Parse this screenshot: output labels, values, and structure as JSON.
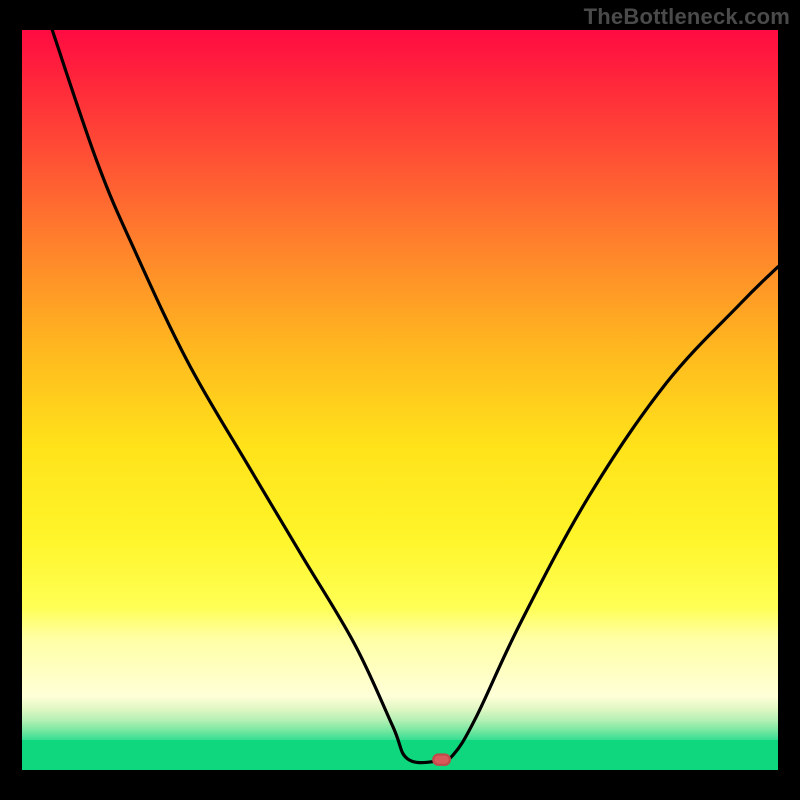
{
  "watermark": "TheBottleneck.com",
  "chart_data": {
    "type": "line",
    "title": "",
    "xlabel": "",
    "ylabel": "",
    "xlim": [
      0,
      100
    ],
    "ylim": [
      0,
      100
    ],
    "grid": false,
    "legend": false,
    "series": [
      {
        "name": "bottleneck-curve",
        "points": [
          {
            "x": 4,
            "y": 100
          },
          {
            "x": 10,
            "y": 82
          },
          {
            "x": 15,
            "y": 70
          },
          {
            "x": 22,
            "y": 55
          },
          {
            "x": 30,
            "y": 41
          },
          {
            "x": 37,
            "y": 29
          },
          {
            "x": 44,
            "y": 17
          },
          {
            "x": 49,
            "y": 6
          },
          {
            "x": 51,
            "y": 1.5
          },
          {
            "x": 55,
            "y": 1.2
          },
          {
            "x": 57,
            "y": 2
          },
          {
            "x": 60,
            "y": 7
          },
          {
            "x": 66,
            "y": 20
          },
          {
            "x": 75,
            "y": 37
          },
          {
            "x": 85,
            "y": 52
          },
          {
            "x": 95,
            "y": 63
          },
          {
            "x": 100,
            "y": 68
          }
        ]
      }
    ],
    "marker": {
      "x": 55.5,
      "y": 1.4,
      "shape": "pill",
      "color": "#d75a5a"
    },
    "background_gradient": {
      "direction": "vertical",
      "stops": [
        {
          "pos": 0.0,
          "color": "#ff0b42"
        },
        {
          "pos": 0.25,
          "color": "#ff5a33"
        },
        {
          "pos": 0.55,
          "color": "#ffb71f"
        },
        {
          "pos": 0.78,
          "color": "#ffff55"
        },
        {
          "pos": 0.9,
          "color": "#ffffd8"
        },
        {
          "pos": 0.96,
          "color": "#35dd93"
        },
        {
          "pos": 1.0,
          "color": "#0ed77d"
        }
      ]
    }
  }
}
